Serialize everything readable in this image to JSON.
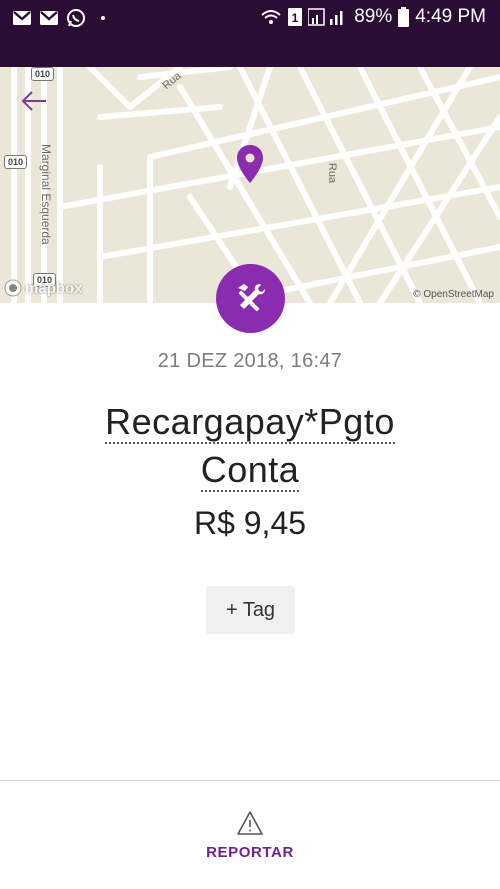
{
  "status_bar": {
    "battery": "89%",
    "time": "4:49 PM",
    "left_icons": [
      "gmail-icon",
      "gmail-icon",
      "whatsapp-icon"
    ],
    "right_icons": [
      "wifi-icon",
      "sim-icon",
      "signal-icon",
      "battery-icon"
    ]
  },
  "map": {
    "road_labels": [
      "Marginal Esquerda",
      "Rua",
      "Rua"
    ],
    "shield_labels": [
      "010",
      "010",
      "010"
    ],
    "logo": "mapbox",
    "attribution": "© OpenStreetMap",
    "background_color": "#eae6d8"
  },
  "transaction": {
    "date": "21 DEZ 2018, 16:47",
    "merchant_line1": "Recargapay*Pgto",
    "merchant_line2": "Conta",
    "amount": "R$ 9,45",
    "category_icon": "tools-icon",
    "accent_color": "#8a2bb0"
  },
  "actions": {
    "tag_label": "+ Tag",
    "report_label": "REPORTAR"
  }
}
